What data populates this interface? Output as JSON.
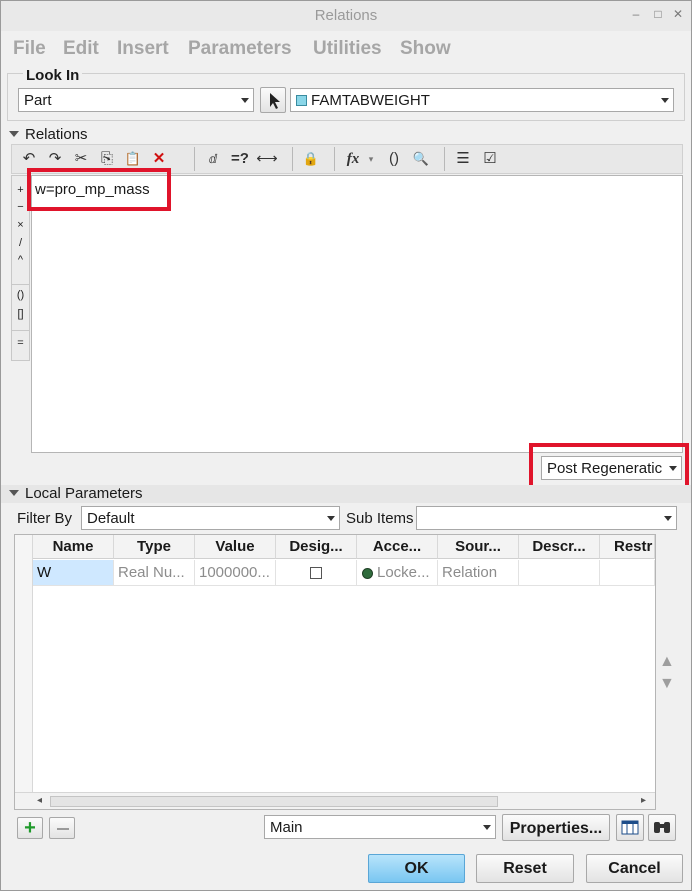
{
  "window": {
    "title": "Relations",
    "controls": [
      "–",
      "□",
      "✕"
    ]
  },
  "menu": [
    "File",
    "Edit",
    "Insert",
    "Parameters",
    "Utilities",
    "Show"
  ],
  "look_in": {
    "label": "Look In",
    "type_value": "Part",
    "object_value": "FAMTABWEIGHT"
  },
  "relations": {
    "section_label": "Relations",
    "text": "w=pro_mp_mass",
    "operators": [
      "+",
      "−",
      "×",
      "/",
      "^",
      "()",
      "[]",
      "="
    ],
    "toolbar_glyphs": [
      "↶",
      "↷",
      "✂",
      "⎘",
      "📋",
      "✕",
      "ⅆ",
      "=?",
      "⟷",
      "🔒",
      "fx",
      "()",
      "🔍",
      "☰",
      "☑"
    ],
    "regen_value": "Post Regeneratic"
  },
  "local_params": {
    "section_label": "Local Parameters",
    "filter_label": "Filter By",
    "filter_value": "Default",
    "subitems_label": "Sub Items",
    "subitems_value": "",
    "columns": [
      "Name",
      "Type",
      "Value",
      "Desig...",
      "Acce...",
      "Sour...",
      "Descr...",
      "Restr"
    ],
    "rows": [
      {
        "name": "W",
        "type": "Real Nu...",
        "value": "1000000...",
        "designated": false,
        "access": "Locke...",
        "source": "Relation",
        "description": "",
        "restricted": ""
      }
    ],
    "view_value": "Main",
    "properties_label": "Properties..."
  },
  "footer": {
    "ok_label": "OK",
    "reset_label": "Reset",
    "cancel_label": "Cancel"
  },
  "colors": {
    "highlight": "#e0142b",
    "ok_button": "#8fd1f5",
    "selected_cell": "#cfe8ff"
  }
}
